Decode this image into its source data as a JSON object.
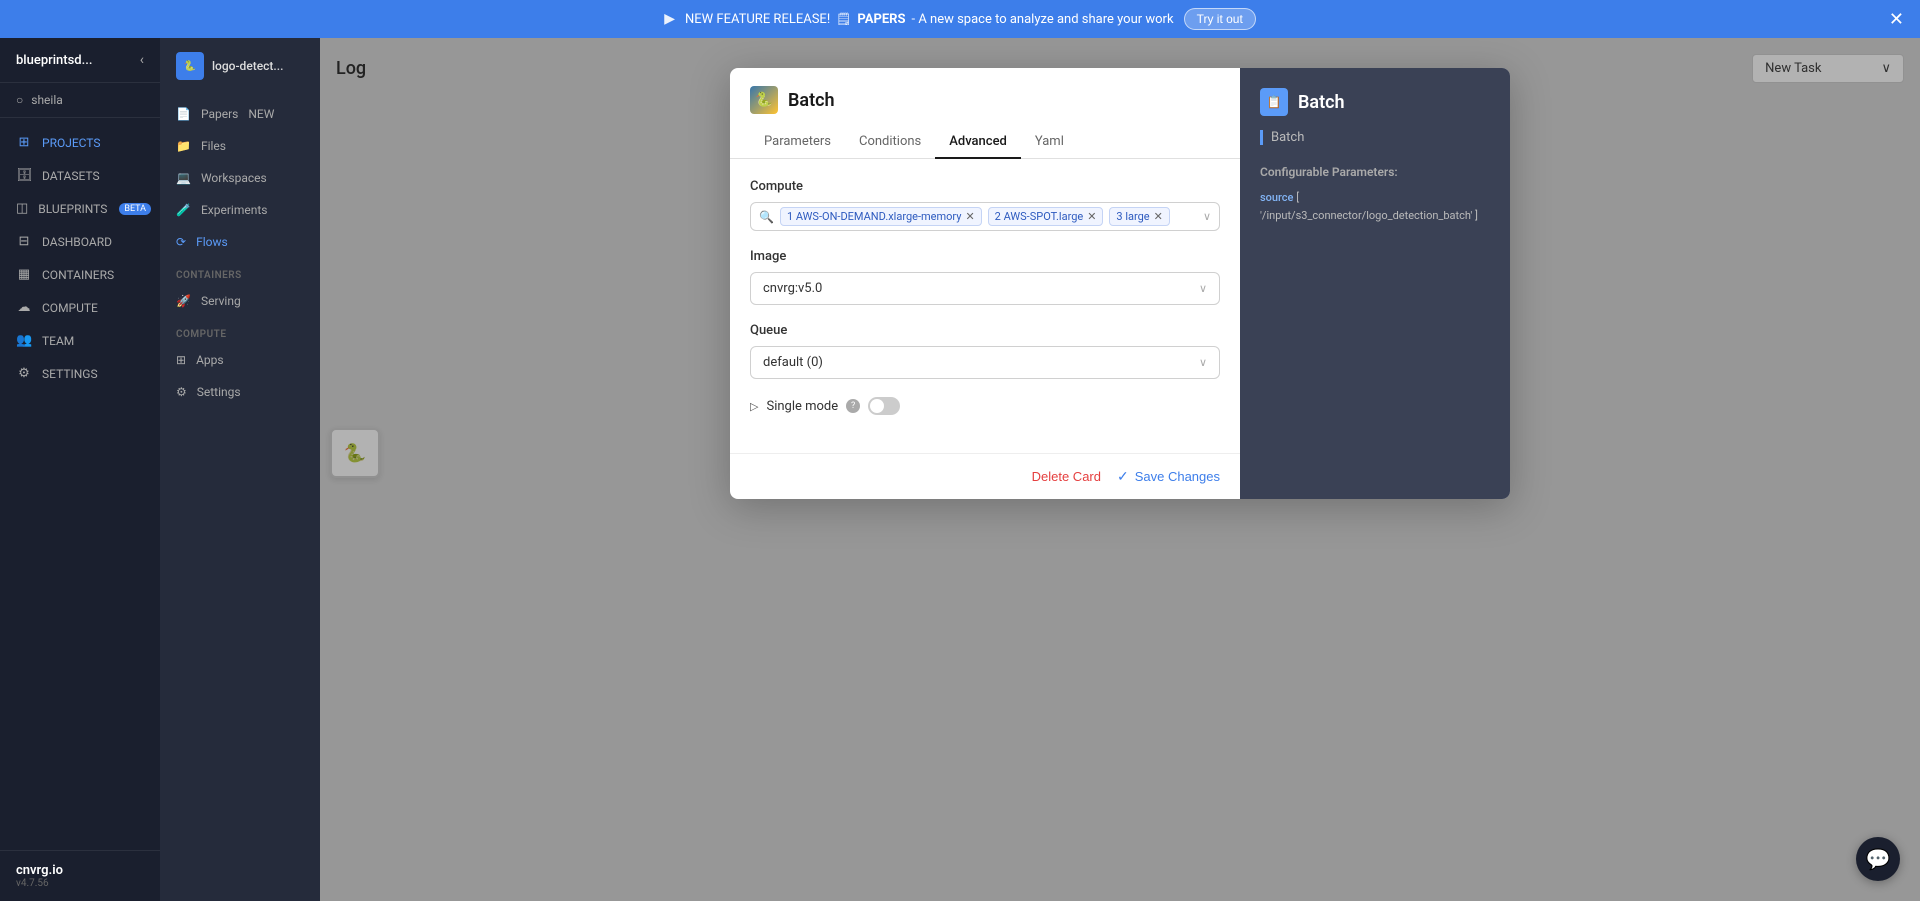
{
  "notif_bar": {
    "play_icon": "▶",
    "text_prefix": "NEW FEATURE RELEASE!",
    "papers_label": "PAPERS",
    "text_suffix": "- A new space to analyze and share your work",
    "try_btn_label": "Try it out",
    "close_icon": "✕"
  },
  "sidebar": {
    "app_name": "blueprintsd...",
    "collapse_icon": "‹",
    "user": "sheila",
    "nav_items": [
      {
        "id": "projects",
        "label": "PROJECTS",
        "icon": "⊞",
        "active": true
      },
      {
        "id": "datasets",
        "label": "DATASETS",
        "icon": "🗄"
      },
      {
        "id": "blueprints",
        "label": "BLUEPRINTS",
        "icon": "◫",
        "badge": "BETA"
      },
      {
        "id": "dashboard",
        "label": "DASHBOARD",
        "icon": "⊟"
      },
      {
        "id": "containers",
        "label": "CONTAINERS",
        "icon": "▦"
      },
      {
        "id": "compute",
        "label": "COMPUTE",
        "icon": "☁"
      },
      {
        "id": "team",
        "label": "TEAM",
        "icon": "👥"
      },
      {
        "id": "settings",
        "label": "SETTINGS",
        "icon": "⚙"
      }
    ],
    "brand": "cnvrg.io",
    "version": "v4.7.56"
  },
  "sub_nav": {
    "project_name": "logo-detect...",
    "items": [
      {
        "id": "papers",
        "label": "Papers",
        "icon": "📄",
        "badge": "NEW"
      },
      {
        "id": "files",
        "label": "Files",
        "icon": "📁"
      },
      {
        "id": "workspaces",
        "label": "Workspaces",
        "icon": "💻"
      },
      {
        "id": "experiments",
        "label": "Experiments",
        "icon": "🧪"
      },
      {
        "id": "flows",
        "label": "Flows",
        "icon": "⟳",
        "active": true
      },
      {
        "id": "serving",
        "label": "Serving",
        "icon": "🚀",
        "section": "CONTAINERS"
      },
      {
        "id": "apps",
        "label": "Apps",
        "icon": "⊞",
        "section": "COMPUTE"
      },
      {
        "id": "settings",
        "label": "Settings",
        "icon": "⚙"
      }
    ]
  },
  "bg": {
    "title": "Log",
    "new_task_label": "New Task",
    "chevron": "∨"
  },
  "dialog": {
    "title": "Batch",
    "python_icon": "🐍",
    "tabs": [
      {
        "id": "parameters",
        "label": "Parameters"
      },
      {
        "id": "conditions",
        "label": "Conditions"
      },
      {
        "id": "advanced",
        "label": "Advanced",
        "active": true
      },
      {
        "id": "yaml",
        "label": "Yaml"
      }
    ],
    "compute_label": "Compute",
    "compute_tags": [
      {
        "label": "1 AWS-ON-DEMAND.xlarge-memory"
      },
      {
        "label": "2 AWS-SPOT.large"
      },
      {
        "label": "3 large"
      }
    ],
    "image_label": "Image",
    "image_value": "cnvrg:v5.0",
    "queue_label": "Queue",
    "queue_value": "default (0)",
    "single_mode_label": "Single mode",
    "info_icon": "?",
    "delete_btn_label": "Delete Card",
    "save_btn_label": "Save Changes",
    "check_icon": "✓"
  },
  "dialog_right": {
    "title": "Batch",
    "subtitle": "Batch",
    "config_params_title": "Configurable Parameters:",
    "source_key": "source",
    "source_value": "[ '/input/s3_connector/logo_detection_batch' ]"
  },
  "chat_btn_icon": "💬"
}
